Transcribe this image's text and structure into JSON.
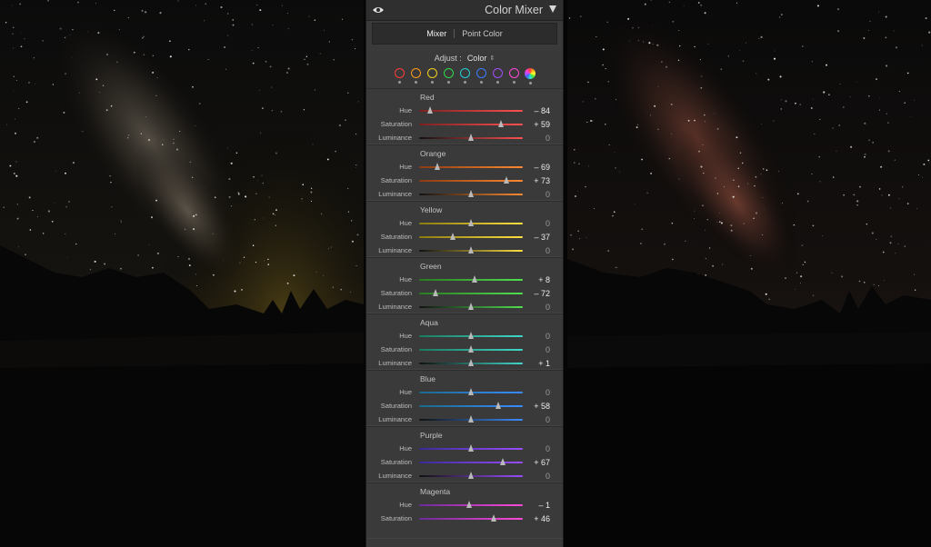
{
  "panel": {
    "title": "Color Mixer",
    "tabs": [
      "Mixer",
      "Point Color"
    ],
    "active_tab": "Mixer",
    "adjust_label": "Adjust :",
    "adjust_value": "Color",
    "adjust_caret": "⌃⌄",
    "swatch_colors": [
      "#ff3a3a",
      "#ff9a1a",
      "#f0d020",
      "#2fd84a",
      "#24d0d8",
      "#3a7cff",
      "#a24dff",
      "#ff48d8",
      "all"
    ]
  },
  "groups": [
    {
      "name": "Red",
      "track_colors": [
        "#7a2020",
        "#ff5050",
        "#6b2a2a"
      ],
      "sliders": [
        {
          "label": "Hue",
          "value": "– 84",
          "fraction": 0.11
        },
        {
          "label": "Saturation",
          "value": "+ 59",
          "fraction": 0.79
        },
        {
          "label": "Luminance",
          "value": "0",
          "fraction": 0.5
        }
      ]
    },
    {
      "name": "Orange",
      "track_colors": [
        "#8a3a12",
        "#ff8a30",
        "#7a4a20"
      ],
      "sliders": [
        {
          "label": "Hue",
          "value": "– 69",
          "fraction": 0.18
        },
        {
          "label": "Saturation",
          "value": "+ 73",
          "fraction": 0.85
        },
        {
          "label": "Luminance",
          "value": "0",
          "fraction": 0.5
        }
      ]
    },
    {
      "name": "Yellow",
      "track_colors": [
        "#8a7a10",
        "#ffe040",
        "#7a7020"
      ],
      "sliders": [
        {
          "label": "Hue",
          "value": "0",
          "fraction": 0.5
        },
        {
          "label": "Saturation",
          "value": "– 37",
          "fraction": 0.33
        },
        {
          "label": "Luminance",
          "value": "0",
          "fraction": 0.5
        }
      ]
    },
    {
      "name": "Green",
      "track_colors": [
        "#2a7a20",
        "#50e050",
        "#2a6a2a"
      ],
      "sliders": [
        {
          "label": "Hue",
          "value": "+ 8",
          "fraction": 0.54
        },
        {
          "label": "Saturation",
          "value": "– 72",
          "fraction": 0.16
        },
        {
          "label": "Luminance",
          "value": "0",
          "fraction": 0.5
        }
      ]
    },
    {
      "name": "Aqua",
      "track_colors": [
        "#1a7a60",
        "#40d8c8",
        "#207070"
      ],
      "sliders": [
        {
          "label": "Hue",
          "value": "0",
          "fraction": 0.5
        },
        {
          "label": "Saturation",
          "value": "0",
          "fraction": 0.5
        },
        {
          "label": "Luminance",
          "value": "+ 1",
          "fraction": 0.5
        }
      ]
    },
    {
      "name": "Blue",
      "track_colors": [
        "#1a6a8a",
        "#3a8cff",
        "#204a7a"
      ],
      "sliders": [
        {
          "label": "Hue",
          "value": "0",
          "fraction": 0.5
        },
        {
          "label": "Saturation",
          "value": "+ 58",
          "fraction": 0.77
        },
        {
          "label": "Luminance",
          "value": "0",
          "fraction": 0.5
        }
      ]
    },
    {
      "name": "Purple",
      "track_colors": [
        "#3a2a9a",
        "#9a4dff",
        "#5a2a7a"
      ],
      "sliders": [
        {
          "label": "Hue",
          "value": "0",
          "fraction": 0.5
        },
        {
          "label": "Saturation",
          "value": "+ 67",
          "fraction": 0.81
        },
        {
          "label": "Luminance",
          "value": "0",
          "fraction": 0.5
        }
      ]
    },
    {
      "name": "Magenta",
      "track_colors": [
        "#6a2a9a",
        "#ff4ad8",
        "#7a2a6a"
      ],
      "sliders": [
        {
          "label": "Hue",
          "value": "– 1",
          "fraction": 0.49
        },
        {
          "label": "Saturation",
          "value": "+ 46",
          "fraction": 0.72
        }
      ]
    }
  ]
}
